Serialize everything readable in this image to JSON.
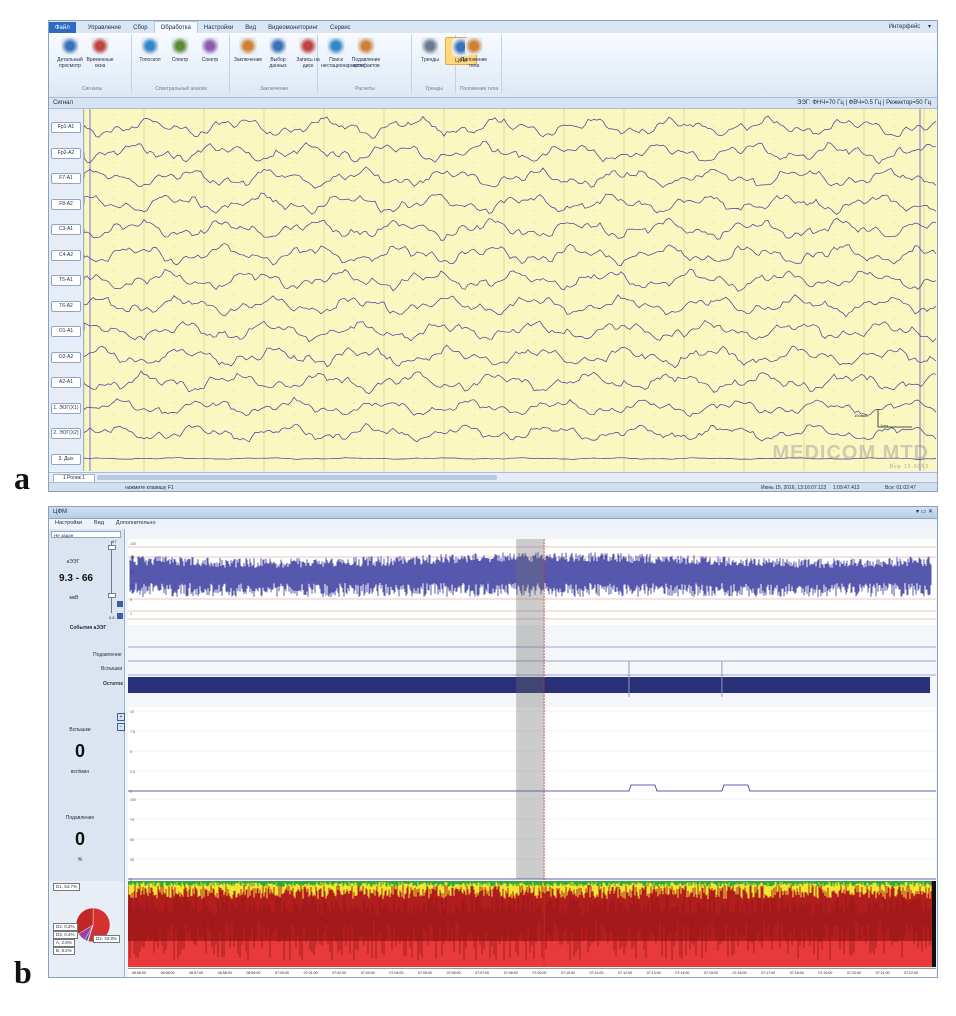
{
  "figure_letters": {
    "a": "a",
    "b": "b"
  },
  "panel_a": {
    "menu": {
      "file": "Файл",
      "items": [
        "Управление",
        "Сбор",
        "Обработка",
        "Настройки",
        "Вид",
        "Видеомониторинг",
        "Сервис"
      ],
      "active_index": 2,
      "right": "Интерфейс"
    },
    "ribbon": {
      "groups": [
        {
          "label": "Сигналы",
          "buttons": [
            "Детальный просмотр",
            "Временные окна"
          ]
        },
        {
          "label": "Спектральный анализ",
          "buttons": [
            "Топоскоп",
            "Спектр",
            "Спектр"
          ]
        },
        {
          "label": "Заключение",
          "buttons": [
            "Заключение",
            "Выбор данных",
            "Запись на диск"
          ]
        },
        {
          "label": "Расчеты",
          "buttons": [
            "Поиск нестационарности",
            "Подавление артефактов"
          ]
        },
        {
          "label": "Тренды",
          "buttons": [
            "Тренды",
            "ЦФМ"
          ]
        },
        {
          "label": "Положение тела",
          "buttons": [
            "Положение тела"
          ]
        }
      ],
      "selected_button": "ЦФМ"
    },
    "signal_bar": {
      "label": "Сигнал",
      "filters": "ЭЭГ: ФНЧ=70 Гц | ФВЧ=0.5 Гц | Режектор=50 Гц"
    },
    "channels": [
      "Fp1-A1",
      "Fp2-A2",
      "F7-A1",
      "F8-A2",
      "C3-A1",
      "C4-A2",
      "T5-A1",
      "T6-A2",
      "O1-A1",
      "O2-A2",
      "A2-A1",
      "1. ЭОГ(X1)",
      "2. ЭОГ(X2)",
      "3. Дых"
    ],
    "scale": {
      "amplitude": "100мкВ",
      "time": "1сек"
    },
    "watermark": {
      "brand": "MEDICOM MTD",
      "version": "Вер 10.0053"
    },
    "page_tab": "1 Ролик 1",
    "status": {
      "hint": "нажмите клавишу F1",
      "date": "Июнь 15, 2016, 13:16:07.113",
      "position": "1:09:47.413",
      "total": "Все: 01:02:47"
    },
    "colors": {
      "eeg_bg": "#fbf7c0",
      "trace": "#3a3aa0",
      "ribbon": "#dde8f5"
    }
  },
  "panel_b": {
    "title": "ЦФМ",
    "menu": [
      "Настройки",
      "Вид",
      "Дополнительно"
    ],
    "dropdown": "Не задан",
    "aeeg": {
      "label": "аЭЭГ",
      "value": "9.3 - 66",
      "unit": "мкВ",
      "slider_top": "67",
      "slider_bottom": "0.6",
      "axis_labels": [
        "100",
        "50",
        "25",
        "10",
        "5",
        "1"
      ]
    },
    "events": {
      "title": "События аЭЭГ",
      "rows": [
        "Подавление",
        "Вспышки",
        "Остаток"
      ],
      "burst_marks": [
        0.62,
        0.735
      ]
    },
    "bursts": {
      "label": "Вспышки",
      "value": "0",
      "unit": "всп/мин",
      "axis_labels": [
        "10",
        "7.5",
        "5",
        "2.5",
        "0"
      ]
    },
    "suppression": {
      "label": "Подавление",
      "value": "0",
      "unit": "%",
      "axis_labels": [
        "100",
        "75",
        "50",
        "25",
        "0"
      ]
    },
    "spectrum": {
      "legend": [
        "D1, 54.7%",
        "D2, 0.2%",
        "D3, 0.4%",
        "A, 2.8%",
        "B, 8.2%",
        "D2, 33.8%"
      ],
      "pie_fractions": [
        0.547,
        0.002,
        0.004,
        0.028,
        0.082,
        0.338
      ]
    },
    "time_ticks": [
      "06:55:00",
      "06:56:00",
      "06:57:00",
      "06:58:00",
      "06:59:00",
      "07:00:00",
      "07:01:00",
      "07:02:00",
      "07:03:00",
      "07:04:00",
      "07:05:00",
      "07:06:00",
      "07:07:00",
      "07:08:00",
      "07:09:00",
      "07:10:00",
      "07:11:00",
      "07:12:00",
      "07:13:00",
      "07:14:00",
      "07:15:00",
      "07:16:00",
      "07:17:00",
      "07:18:00",
      "07:19:00",
      "07:20:00",
      "07:21:00",
      "07:22:00"
    ],
    "cursor_fraction": 0.515,
    "colors": {
      "aeeg": "#2c2f9a",
      "residue_bar": "#2a3078",
      "spectrum_low": "#e23030",
      "spectrum_mid": "#f2e630",
      "spectrum_high": "#2ea83a"
    }
  }
}
